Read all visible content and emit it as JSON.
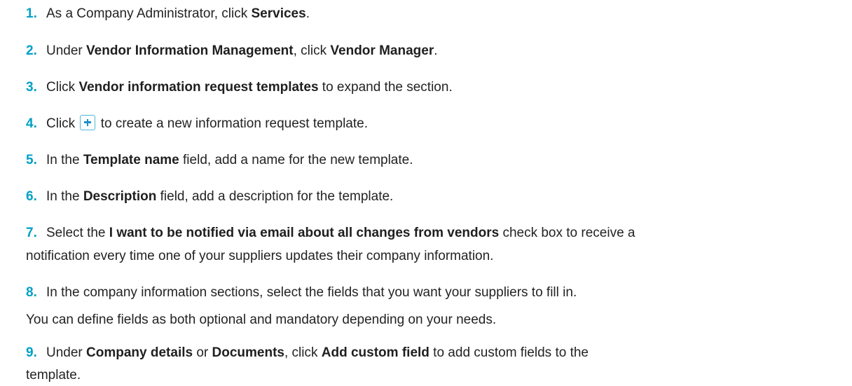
{
  "steps": [
    {
      "num": "1.",
      "pre": "As a Company Administrator, click ",
      "b1": "Services",
      "post": "."
    },
    {
      "num": "2.",
      "pre": "Under ",
      "b1": "Vendor Information Management",
      "mid": ", click ",
      "b2": "Vendor Manager",
      "post": "."
    },
    {
      "num": "3.",
      "pre": "Click ",
      "b1": "Vendor information request templates",
      "post": " to expand the section."
    },
    {
      "num": "4.",
      "pre": "Click ",
      "icon": "plus-icon",
      "post": " to create a new information request template."
    },
    {
      "num": "5.",
      "pre": "In the ",
      "b1": "Template name",
      "post": " field, add a name for the new template."
    },
    {
      "num": "6.",
      "pre": "In the ",
      "b1": "Description",
      "post": " field, add a description for the template."
    },
    {
      "num": "7.",
      "pre": "Select the ",
      "b1": "I want to be notified via email about all changes from vendors",
      "post": " check box to receive a",
      "line2": "notification every time one of your suppliers updates their company information."
    },
    {
      "num": "8.",
      "pre": "In the company information sections, select the fields that you want your suppliers to fill in.",
      "line2": "You can define fields as both optional and mandatory depending on your needs."
    },
    {
      "num": "9.",
      "pre": "Under ",
      "b1": "Company details",
      "mid": " or ",
      "b2": "Documents",
      "mid2": ", click ",
      "b3": "Add custom field",
      "post": " to add custom fields to the",
      "line2": "template."
    }
  ],
  "colors": {
    "number": "#00a0c6",
    "text": "#232323",
    "icon_border": "#4fb6d8"
  }
}
